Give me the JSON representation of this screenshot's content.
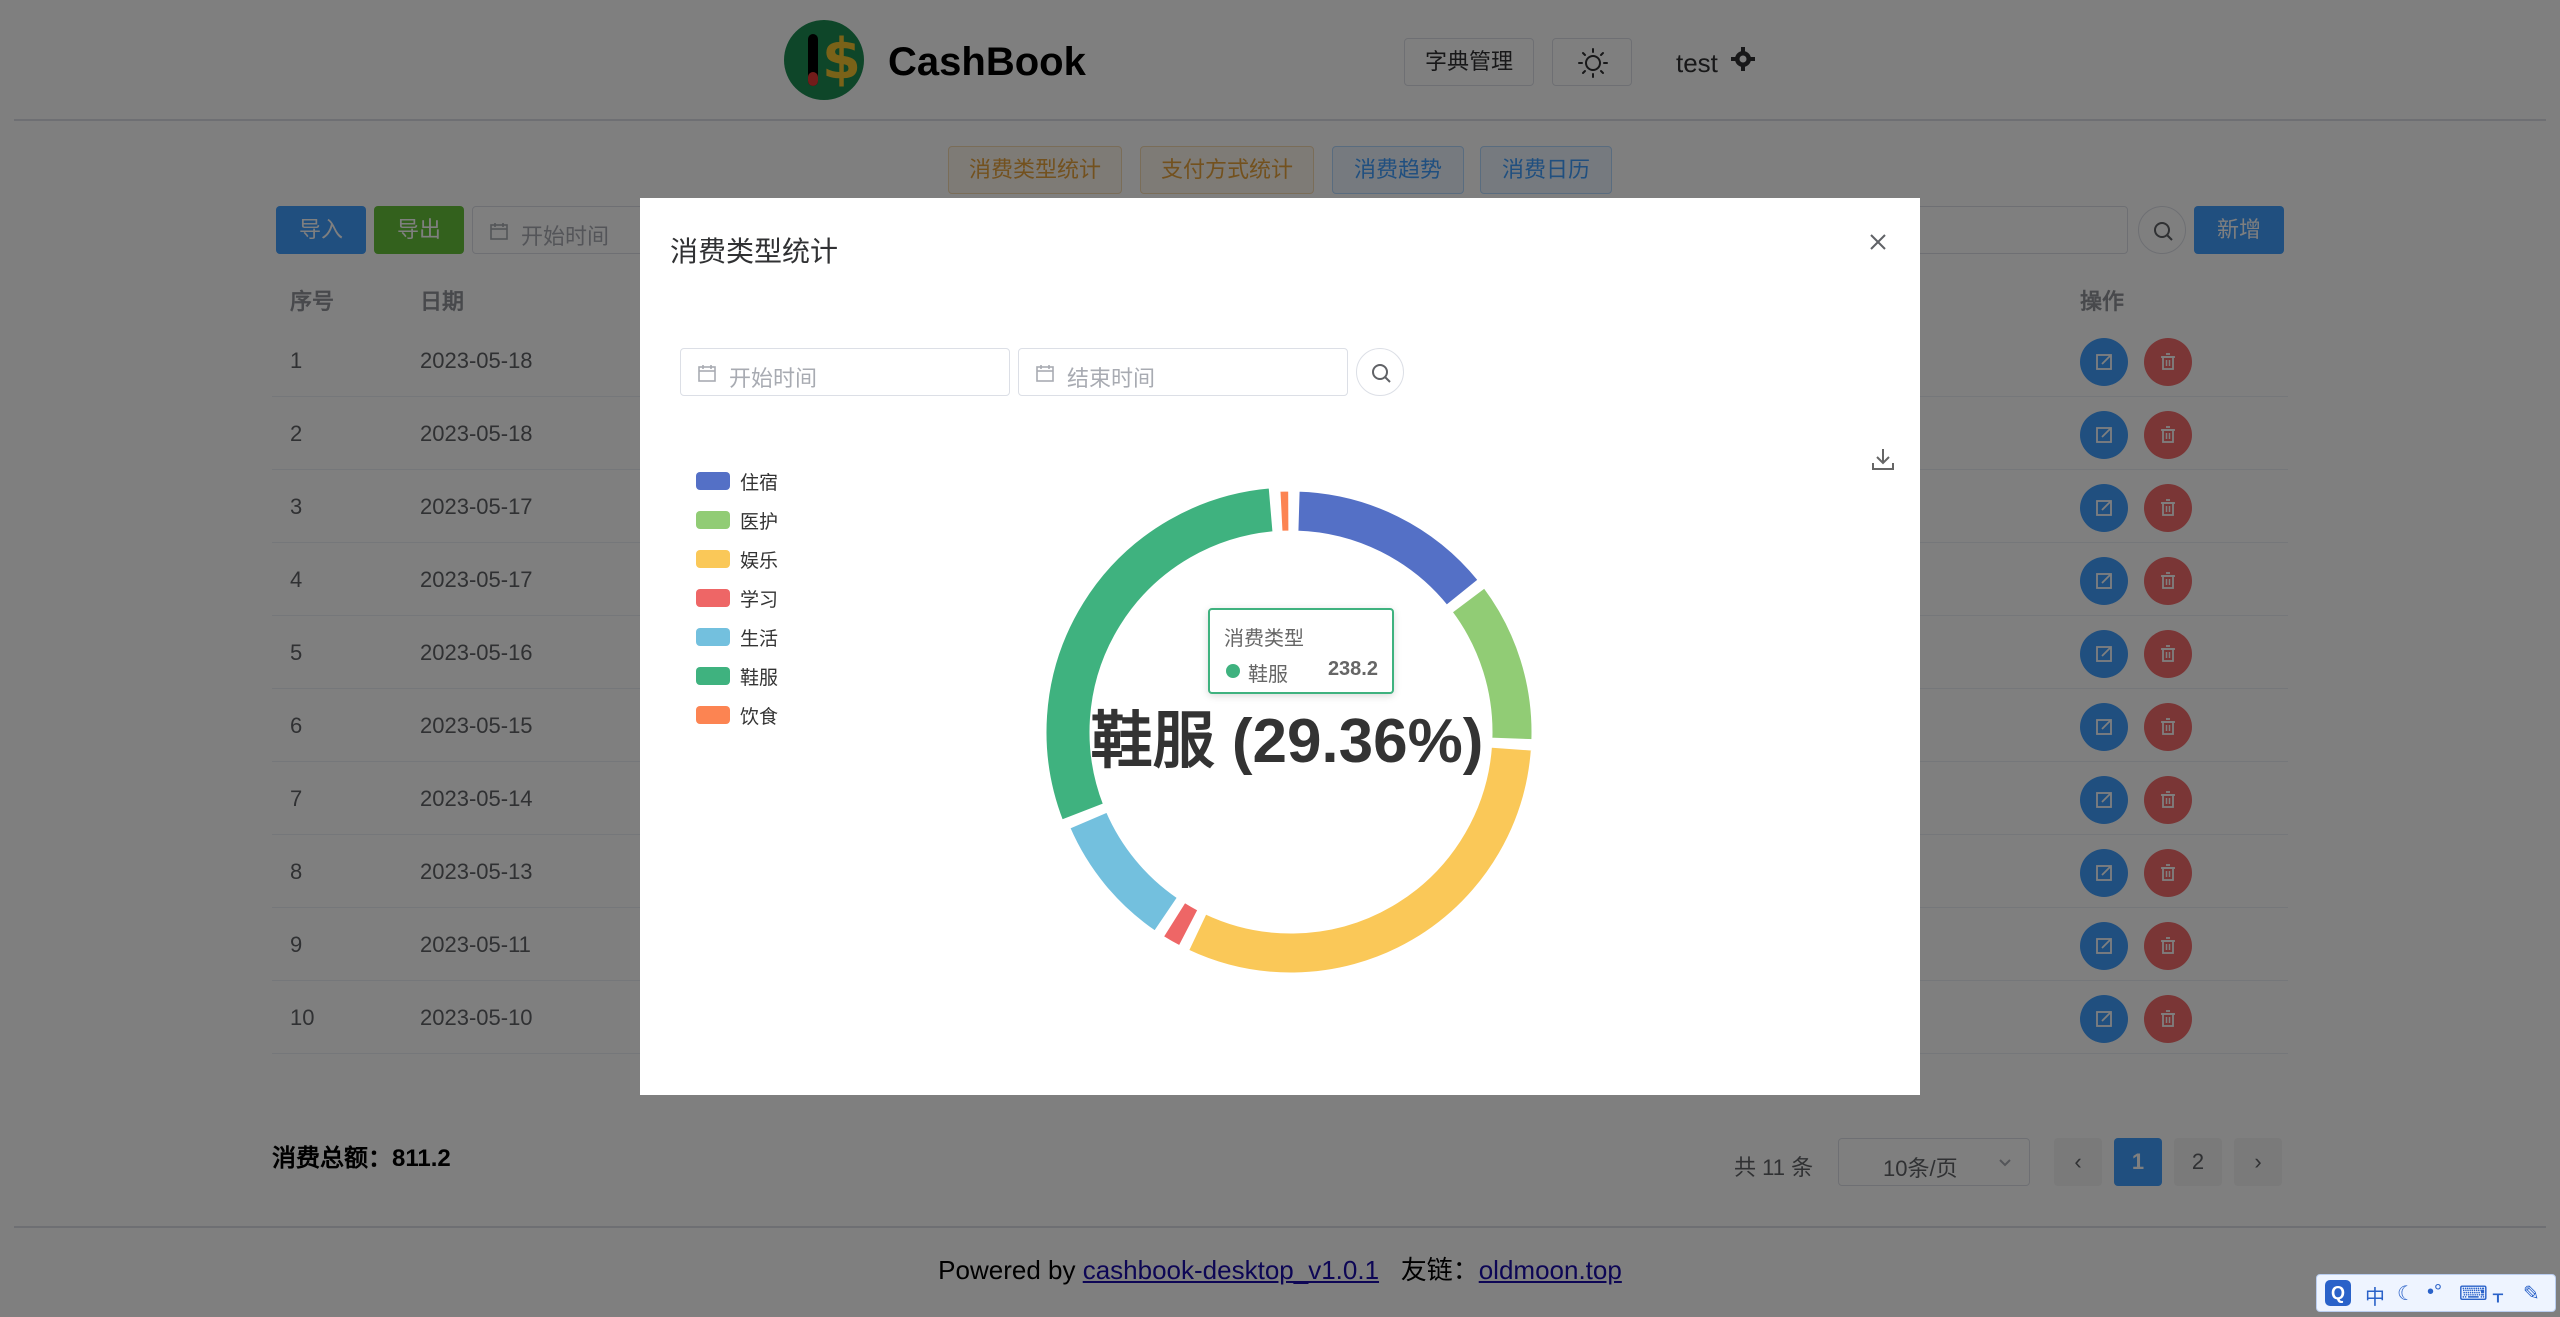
{
  "app": {
    "title": "CashBook",
    "dict_button": "字典管理",
    "user": "test"
  },
  "tabs": [
    {
      "label": "消费类型统计"
    },
    {
      "label": "支付方式统计"
    },
    {
      "label": "消费趋势"
    },
    {
      "label": "消费日历"
    }
  ],
  "toolbar": {
    "import_label": "导入",
    "export_label": "导出",
    "start_placeholder": "开始时间",
    "add_label": "新增"
  },
  "table": {
    "headers": {
      "index": "序号",
      "date": "日期",
      "ops": "操作"
    },
    "rows": [
      {
        "index": "1",
        "date": "2023-05-18"
      },
      {
        "index": "2",
        "date": "2023-05-18"
      },
      {
        "index": "3",
        "date": "2023-05-17"
      },
      {
        "index": "4",
        "date": "2023-05-17"
      },
      {
        "index": "5",
        "date": "2023-05-16"
      },
      {
        "index": "6",
        "date": "2023-05-15"
      },
      {
        "index": "7",
        "date": "2023-05-14"
      },
      {
        "index": "8",
        "date": "2023-05-13"
      },
      {
        "index": "9",
        "date": "2023-05-11"
      },
      {
        "index": "10",
        "date": "2023-05-10"
      }
    ]
  },
  "summary": {
    "total": "消费总额：811.2",
    "count": "共 11 条",
    "page_size": "10条/页",
    "pages": [
      "1",
      "2"
    ],
    "current_page": "1"
  },
  "footer": {
    "powered_by": "Powered by",
    "project_link": "cashbook-desktop_v1.0.1",
    "friend_label": "友链：",
    "friend_link": "oldmoon.top"
  },
  "modal": {
    "title": "消费类型统计",
    "start_placeholder": "开始时间",
    "end_placeholder": "结束时间",
    "tooltip": {
      "title": "消费类型",
      "name": "鞋服",
      "value": "238.2",
      "color": "#3fb27f"
    },
    "center_label": "鞋服 (29.36%)"
  },
  "chart_data": {
    "type": "pie",
    "donut": true,
    "legend_position": "left",
    "categories": [
      "住宿",
      "医护",
      "娱乐",
      "学习",
      "生活",
      "鞋服",
      "饮食"
    ],
    "values": [
      113,
      90,
      249,
      15,
      76,
      238.2,
      10
    ],
    "colors": [
      "#5470c6",
      "#91cc75",
      "#fac858",
      "#ee6666",
      "#73c0de",
      "#3fb27f",
      "#fc8452"
    ],
    "highlighted": "鞋服"
  },
  "ime": {
    "labels": [
      "中",
      "☾",
      "•°",
      "⌨",
      "ᚁ",
      "✎"
    ]
  }
}
